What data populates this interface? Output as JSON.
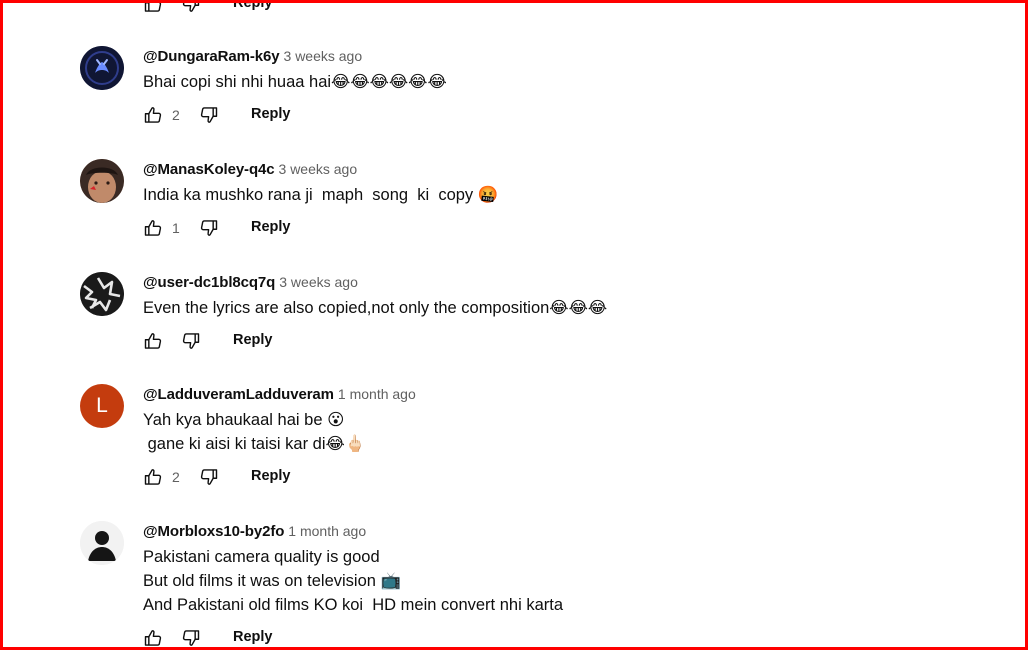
{
  "top_partial": {
    "reply_label": "Reply"
  },
  "comments": [
    {
      "author": "@DungaraRam-k6y",
      "time": "3 weeks ago",
      "text": "Bhai copi shi nhi huaa hai😂😂😂😂😂😂",
      "likes": "2",
      "reply_label": "Reply"
    },
    {
      "author": "@ManasKoley-q4c",
      "time": "3 weeks ago",
      "text": "India ka mushko rana ji  maph  song  ki  copy 🤬",
      "likes": "1",
      "reply_label": "Reply"
    },
    {
      "author": "@user-dc1bl8cq7q",
      "time": "3 weeks ago",
      "text": "Even the lyrics are also copied,not only the composition😂😂😂",
      "likes": "",
      "reply_label": "Reply"
    },
    {
      "author": "@LadduveramLadduveram",
      "time": "1 month ago",
      "text": "Yah kya bhaukaal hai be 😮\n gane ki aisi ki taisi kar di😂🖕🏻",
      "likes": "2",
      "reply_label": "Reply",
      "avatar_letter": "L"
    },
    {
      "author": "@Morbloxs10-by2fo",
      "time": "1 month ago",
      "text": "Pakistani camera quality is good\nBut old films it was on television 📺\nAnd Pakistani old films KO koi  HD mein convert nhi karta",
      "likes": "",
      "reply_label": "Reply"
    }
  ],
  "colors": {
    "frame": "#ff0000",
    "avatar_L_bg": "#c43c0e",
    "meta_gray": "#606060"
  },
  "icons": [
    "thumb-up-icon",
    "thumb-down-icon"
  ]
}
